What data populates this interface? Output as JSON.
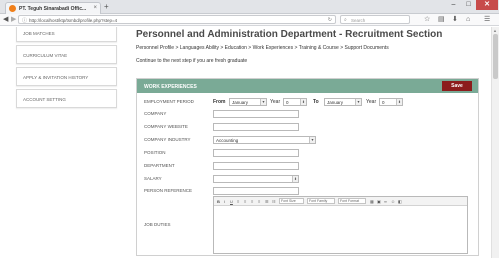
{
  "browser": {
    "tab_title": "PT. Teguh Sinarabadi Offic...",
    "tab_close": "×",
    "new_tab": "+",
    "url": "http://localhost/ktp/tsmbd/profile.php?step=4",
    "search_placeholder": "Search",
    "window": {
      "minimize": "–",
      "maximize": "□",
      "close": "✕"
    }
  },
  "sidebar": {
    "items": [
      {
        "label": "JOB MATCHES"
      },
      {
        "label": "CURRICULUM VITAE"
      },
      {
        "label": "APPLY & INVITATION HISTORY"
      },
      {
        "label": "ACCOUNT SETTING"
      }
    ]
  },
  "main": {
    "page_title": "Personnel and Administration Department - Recruitment Section",
    "breadcrumb": "Personnel Profile > Languages Ability > Education > Work Experiences > Training & Course > Support Documents",
    "next_step_text": "Continue to the next step if you are fresh graduate"
  },
  "panel": {
    "title": "WORK EXPERIENCES",
    "save_label": "Save",
    "fields": {
      "employment_period": "EMPLOYMENT PERIOD",
      "company": "COMPANY",
      "company_website": "COMPANY WEBSITE",
      "company_industry": "COMPANY INDUSTRY",
      "position": "POSITION",
      "department": "DEPARTMENT",
      "salary": "SALARY",
      "person_reference": "PERSON REFERENCE",
      "job_duties": "JOB DUTIES"
    },
    "period": {
      "from_label": "From",
      "to_label": "To",
      "year_label": "Year",
      "from_month": "January",
      "from_year": "0",
      "to_month": "January",
      "to_year": "0"
    },
    "company_industry_value": "Accounting",
    "editor": {
      "font_size": "Font Size",
      "font_family": "Font Family",
      "font_format": "Font Format"
    }
  }
}
